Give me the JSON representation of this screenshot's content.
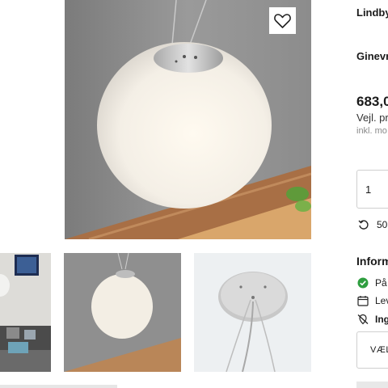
{
  "product": {
    "brand": "Lindby",
    "name": "Ginevr",
    "price": "683,0",
    "recommended_price": "Vejl. pr",
    "vat_note": "inkl. mo"
  },
  "quantity": {
    "value": "1"
  },
  "returns": {
    "text": "50"
  },
  "info": {
    "heading": "Inform",
    "items": [
      {
        "icon": "check-circle-icon",
        "text": "På"
      },
      {
        "icon": "calendar-icon",
        "text": "Lev"
      },
      {
        "icon": "no-delivery-icon",
        "text": "Ing"
      }
    ]
  },
  "select_button": {
    "label": "VÆL"
  },
  "colors": {
    "accent_green": "#2e9e3f",
    "wall": "#8a8a8a",
    "wood": "#b9875a"
  }
}
